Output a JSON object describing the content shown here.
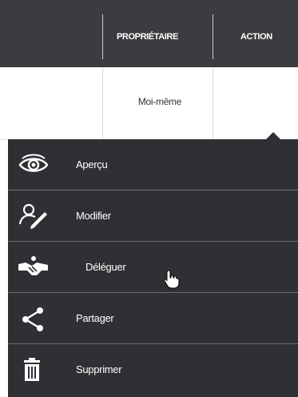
{
  "table": {
    "headers": {
      "owner": "PROPRIÉTAIRE",
      "action": "ACTION"
    },
    "rows": [
      {
        "owner": "Moi-même"
      }
    ]
  },
  "menu": {
    "items": [
      {
        "label": "Aperçu",
        "icon": "eye-icon"
      },
      {
        "label": "Modifier",
        "icon": "user-edit-icon"
      },
      {
        "label": "Déléguer",
        "icon": "handshake-icon"
      },
      {
        "label": "Partager",
        "icon": "share-icon"
      },
      {
        "label": "Supprimer",
        "icon": "trash-icon"
      }
    ]
  },
  "colors": {
    "header_bg": "#3b3c3f",
    "menu_bg": "#2f3033",
    "divider": "#6b6c70",
    "text": "#ffffff"
  }
}
